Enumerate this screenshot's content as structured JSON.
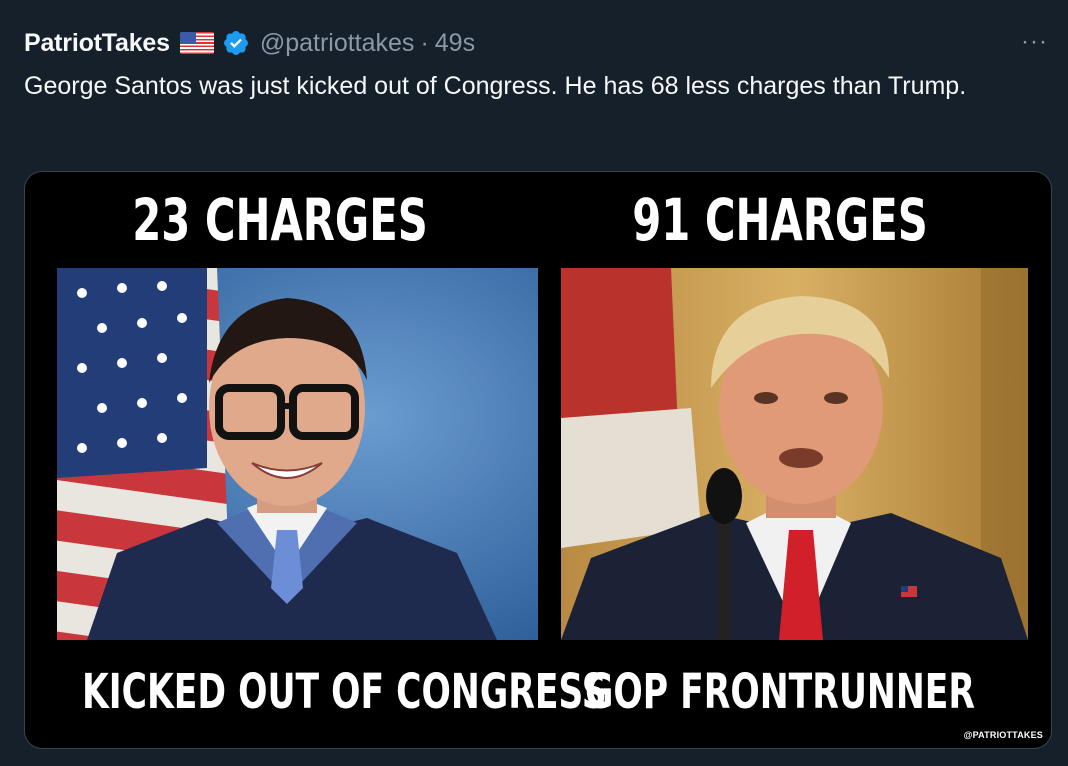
{
  "author": {
    "display_name": "PatriotTakes",
    "handle": "@patriottakes",
    "separator": "·",
    "timestamp": "49s",
    "flag_icon": "us-flag-emoji",
    "verified_icon": "verified-badge-icon",
    "verified_color": "#1d9bf0"
  },
  "more_menu": {
    "label": "···"
  },
  "tweet": {
    "text": "George Santos was just kicked out of Congress. He has 68 less charges than Trump."
  },
  "media": {
    "left": {
      "headline": "23 CHARGES",
      "caption": "KICKED OUT OF CONGRESS",
      "photo": "george-santos-portrait"
    },
    "right": {
      "headline": "91 CHARGES",
      "caption": "GOP FRONTRUNNER",
      "photo": "donald-trump-portrait"
    },
    "watermark": "@PATRIOTTAKES"
  },
  "colors": {
    "background": "#15202b",
    "text": "#f7f9f9",
    "secondary": "#8b98a5",
    "media_bg": "#000000"
  }
}
